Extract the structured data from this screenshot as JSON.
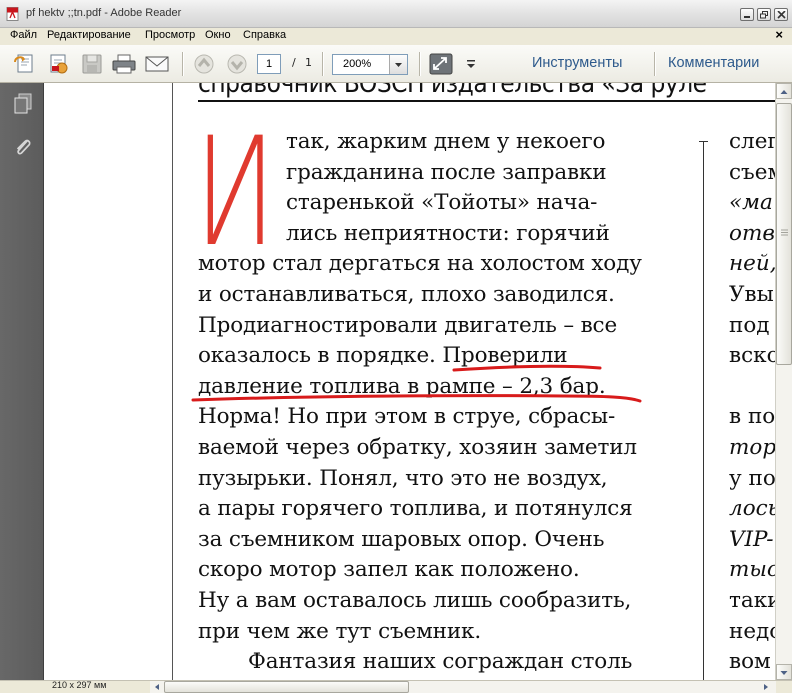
{
  "window": {
    "title": "pf hektv ;;tn.pdf - Adobe Reader"
  },
  "menu": {
    "items": [
      {
        "label": "Файл"
      },
      {
        "label": "Редактирование"
      },
      {
        "label": "Просмотр"
      },
      {
        "label": "Окно"
      },
      {
        "label": "Справка"
      }
    ],
    "close_glyph": "×"
  },
  "toolbar": {
    "page_current": "1",
    "page_separator": "/",
    "page_total": "1",
    "zoom": "200%",
    "tools_label": "Инструменты",
    "comments_label": "Комментарии"
  },
  "document": {
    "header": "справочник BOSCH издательства «За руле",
    "drop_cap": "И",
    "column1_lines": [
      "так, жарким днем у некоего",
      "гражданина после заправки",
      "старенькой «Тойоты» нача-",
      "лись неприятности: горячий",
      "мотор стал дергаться на холостом ходу",
      "и останавливаться, плохо заводился.",
      "Продиагностировали двигатель – все",
      "оказалось в порядке. Проверили",
      "давление топлива в рампе – 2,3 бар.",
      "Норма! Но при этом в струе, сбрасы-",
      "ваемой через обратку, хозяин заметил",
      "пузырьки. Понял, что это не воздух,",
      "а пары горячего топлива, и потянулся",
      "за съемником шаровых опор. Очень",
      "скоро мотор запел как положено.",
      "Ну а вам оставалось лишь сообразить,",
      "при чем же тут съемник.",
      "Фантазия наших сограждан столь"
    ],
    "column2_lines": [
      {
        "text": "слеп",
        "italic": false
      },
      {
        "text": "съем",
        "italic": false
      },
      {
        "text": "«ма",
        "italic": true
      },
      {
        "text": "отв",
        "italic": true
      },
      {
        "text": "ней,",
        "italic": true
      },
      {
        "text": "Увы",
        "italic": false
      },
      {
        "text": "под",
        "italic": false
      },
      {
        "text": "вско",
        "italic": false
      },
      {
        "text": "",
        "italic": false
      },
      {
        "text": "в по",
        "italic": false
      },
      {
        "text": "тор",
        "italic": true
      },
      {
        "text": "у по",
        "italic": false
      },
      {
        "text": "лось",
        "italic": true
      },
      {
        "text": "VIP-",
        "italic": true
      },
      {
        "text": "тыс",
        "italic": true
      },
      {
        "text": "таки",
        "italic": false
      },
      {
        "text": "недо",
        "italic": false
      },
      {
        "text": "вом",
        "italic": false
      }
    ],
    "accent_color": "#e03a2f",
    "annotation_color": "#d81b1b"
  },
  "status": {
    "page_size": "210 x 297 мм"
  }
}
